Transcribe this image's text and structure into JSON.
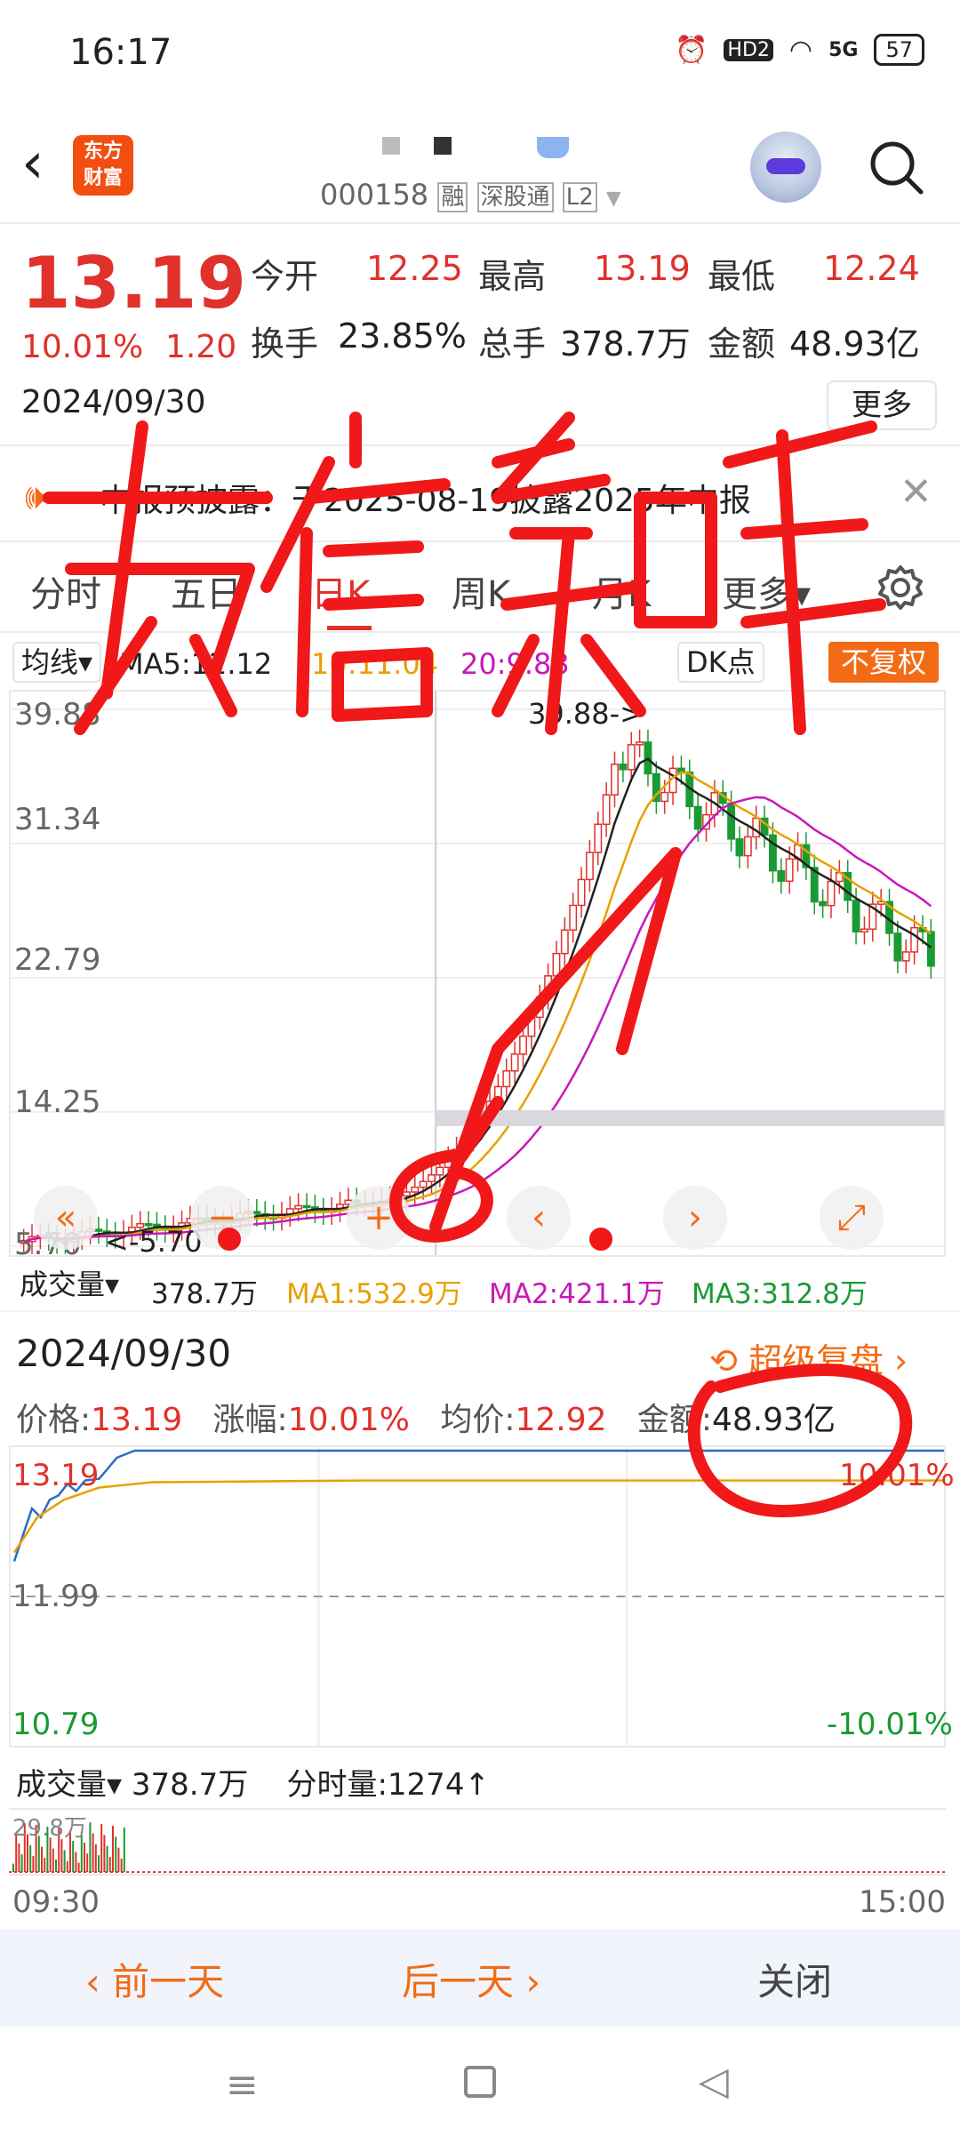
{
  "status_bar": {
    "time": "16:17",
    "network": "5G",
    "hd": "HD2",
    "battery": "57"
  },
  "header": {
    "logo_line1": "东方",
    "logo_line2": "财富",
    "code": "000158",
    "tag_margin": "融",
    "tag_connect": "深股通",
    "tag_level": "L2"
  },
  "quote": {
    "price": "13.19",
    "pct_change": "10.01%",
    "change": "1.20",
    "date": "2024/09/30",
    "open_label": "今开",
    "open": "12.25",
    "high_label": "最高",
    "high": "13.19",
    "low_label": "最低",
    "low": "12.24",
    "turnover_label": "换手",
    "turnover": "23.85%",
    "volume_label": "总手",
    "volume": "378.7万",
    "amount_label": "金额",
    "amount": "48.93亿",
    "more": "更多"
  },
  "notice": {
    "text": "中报预披露：于2025-08-19披露2025年中报"
  },
  "tabs": [
    {
      "label": "分时"
    },
    {
      "label": "五日"
    },
    {
      "label": "日K"
    },
    {
      "label": "周K"
    },
    {
      "label": "月K"
    },
    {
      "label": "更多▾"
    }
  ],
  "ma_row": {
    "selector": "均线",
    "ma5": "MA5:12.12",
    "ma10": "10:11.04",
    "ma20": "20:9.83",
    "dk": "DK点",
    "adjust": "不复权"
  },
  "kline": {
    "y_labels": [
      "39.88",
      "31.34",
      "22.79",
      "14.25",
      "5.70"
    ],
    "max_marker": "39.88->",
    "min_marker": "<-5.70"
  },
  "vol_row": {
    "selector": "成交量",
    "vol": "378.7万",
    "ma1": "MA1:532.9万",
    "ma2": "MA2:421.1万",
    "ma3": "MA3:312.8万"
  },
  "intraday": {
    "date": "2024/09/30",
    "replay": "超级复盘",
    "price_label": "价格:",
    "price": "13.19",
    "pct_label": "涨幅:",
    "pct": "10.01%",
    "avg_label": "均价:",
    "avg": "12.92",
    "amount_label": "金额:",
    "amount": "48.93亿",
    "y_top": "13.19",
    "y_mid": "11.99",
    "y_bot": "10.79",
    "pct_top": "10.01%",
    "pct_bot": "-10.01%",
    "vol_selector": "成交量",
    "vol": "378.7万",
    "tick_vol": "分时量:1274",
    "vol_axis": "29.8万",
    "time_start": "09:30",
    "time_end": "15:00"
  },
  "bottom": {
    "prev": "前一天",
    "next": "后一天",
    "close": "关闭"
  },
  "handwriting": "东信宏时",
  "colors": {
    "up": "#e0312b",
    "down": "#1a9a32",
    "accent": "#f36b16",
    "ma5": "#222222",
    "ma10": "#e8a000",
    "ma20": "#c818b8"
  }
}
